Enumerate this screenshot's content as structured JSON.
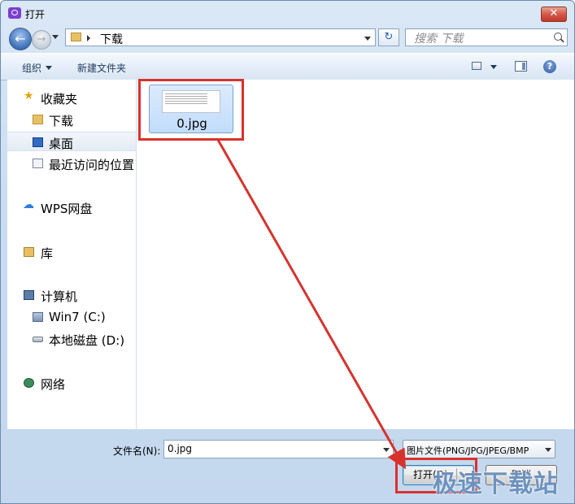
{
  "window": {
    "title": "打开",
    "close_label": "✕"
  },
  "nav": {
    "back_glyph": "←",
    "forward_glyph": "→",
    "address_path": "下载",
    "refresh_glyph": "↻",
    "search_placeholder": "搜索 下载"
  },
  "toolbar": {
    "organize_label": "组织",
    "new_folder_label": "新建文件夹",
    "help_glyph": "?"
  },
  "sidebar": {
    "items": [
      {
        "label": "收藏夹",
        "icon": "star-icon"
      },
      {
        "label": "下载",
        "icon": "folder-icon"
      },
      {
        "label": "桌面",
        "icon": "desktop-icon",
        "selected": true
      },
      {
        "label": "最近访问的位置",
        "icon": "recent-places-icon"
      },
      {
        "label": "WPS网盘",
        "icon": "cloud-icon"
      },
      {
        "label": "库",
        "icon": "library-icon"
      },
      {
        "label": "计算机",
        "icon": "computer-icon"
      },
      {
        "label": "Win7 (C:)",
        "icon": "drive-c-icon"
      },
      {
        "label": "本地磁盘 (D:)",
        "icon": "drive-d-icon"
      },
      {
        "label": "网络",
        "icon": "network-icon"
      }
    ]
  },
  "files": [
    {
      "name": "0.jpg",
      "selected": true
    }
  ],
  "bottom": {
    "filename_label": "文件名(N):",
    "filename_value": "0.jpg",
    "filetype_value": "图片文件(PNG/JPG/JPEG/BMP",
    "open_label": "打开(O)",
    "cancel_label": "取消"
  },
  "annotation": {
    "color": "#d8322d"
  },
  "watermark": "极速下载站"
}
